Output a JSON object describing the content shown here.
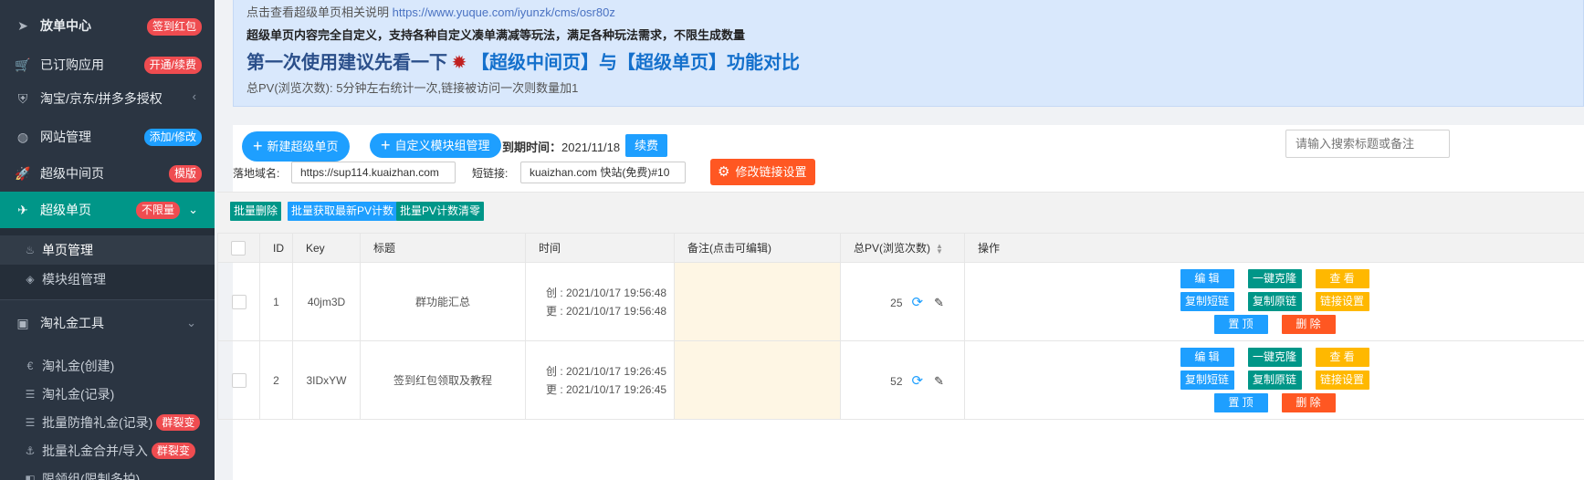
{
  "sidebar": {
    "items": [
      {
        "label": "放单中心",
        "badge": "签到红包",
        "icon": "paper-plane-icon"
      },
      {
        "label": "已订购应用",
        "badge": "开通/续费",
        "icon": "cart-icon"
      },
      {
        "label": "淘宝/京东/拼多多授权",
        "icon": "shield-icon"
      },
      {
        "label": "网站管理",
        "badge": "添加/修改",
        "icon": "globe-icon"
      },
      {
        "label": "超级中间页",
        "badge": "模版",
        "icon": "rocket-icon"
      },
      {
        "label": "超级单页",
        "badge": "不限量",
        "icon": "send-icon"
      }
    ],
    "sub_items": [
      {
        "label": "单页管理",
        "icon": "fire-icon"
      },
      {
        "label": "模块组管理",
        "icon": "layers-icon"
      }
    ],
    "tools": {
      "label": "淘礼金工具",
      "icon": "briefcase-icon"
    },
    "tool_items": [
      {
        "label": "淘礼金(创建)",
        "icon": "euro-icon"
      },
      {
        "label": "淘礼金(记录)",
        "icon": "list-icon"
      },
      {
        "label": "批量防撸礼金(记录)",
        "badge": "群裂变",
        "icon": "list-icon"
      },
      {
        "label": "批量礼金合并/导入",
        "badge": "群裂变",
        "icon": "anchor-icon"
      },
      {
        "label": "限领组(限制多拍)",
        "icon": "box-icon"
      }
    ]
  },
  "notice": {
    "line1_text": "点击查看超级单页相关说明",
    "line1_link": "https://www.yuque.com/iyunzk/cms/osr80z",
    "line2": "超级单页内容完全自定义，支持各种自定义凑单满减等玩法，满足各种玩法需求，不限生成数量",
    "line3_prefix": "第一次使用建议先看一下",
    "line3_main": "【超级中间页】与【超级单页】功能对比",
    "line4": "总PV(浏览次数): 5分钟左右统计一次,链接被访问一次则数量加1"
  },
  "toolbar": {
    "new_page": "新建超级单页",
    "custom_module": "自定义模块组管理",
    "expire_label": "到期时间：",
    "expire_value": "2021/11/18",
    "renew": "续费",
    "search_placeholder": "请输入搜索标题或备注",
    "domain_label": "落地域名:",
    "domain_value": "https://sup114.kuaizhan.com",
    "short_label": "短链接:",
    "short_value": "kuaizhan.com 快站(免费)#10",
    "modify_link": "修改链接设置",
    "batch_delete": "批量删除",
    "batch_fetch": "批量获取最新PV计数",
    "batch_clear": "批量PV计数清零"
  },
  "table": {
    "headers": [
      "ID",
      "Key",
      "标题",
      "时间",
      "备注(点击可编辑)",
      "总PV(浏览次数)",
      "操作"
    ],
    "rows": [
      {
        "id": "1",
        "key": "40jm3D",
        "title": "群功能汇总",
        "created": "创 : 2021/10/17 19:56:48",
        "updated": "更 : 2021/10/17 19:56:48",
        "note": "",
        "pv": "25"
      },
      {
        "id": "2",
        "key": "3IDxYW",
        "title": "签到红包领取及教程",
        "created": "创 : 2021/10/17 19:26:45",
        "updated": "更 : 2021/10/17 19:26:45",
        "note": "",
        "pv": "52"
      }
    ],
    "actions": {
      "edit": "编 辑",
      "clone": "一键克隆",
      "view": "查 看",
      "copy_short": "复制短链",
      "copy_origin": "复制原链",
      "link_settings": "链接设置",
      "pin": "置 顶",
      "delete": "删 除"
    }
  },
  "colors": {
    "sidebar_bg": "#2b3542",
    "active_teal": "#009688",
    "primary_blue": "#1e9fff",
    "warn_orange": "#ffb800",
    "danger": "#ff5722",
    "notice_bg": "#d9e8fc"
  }
}
